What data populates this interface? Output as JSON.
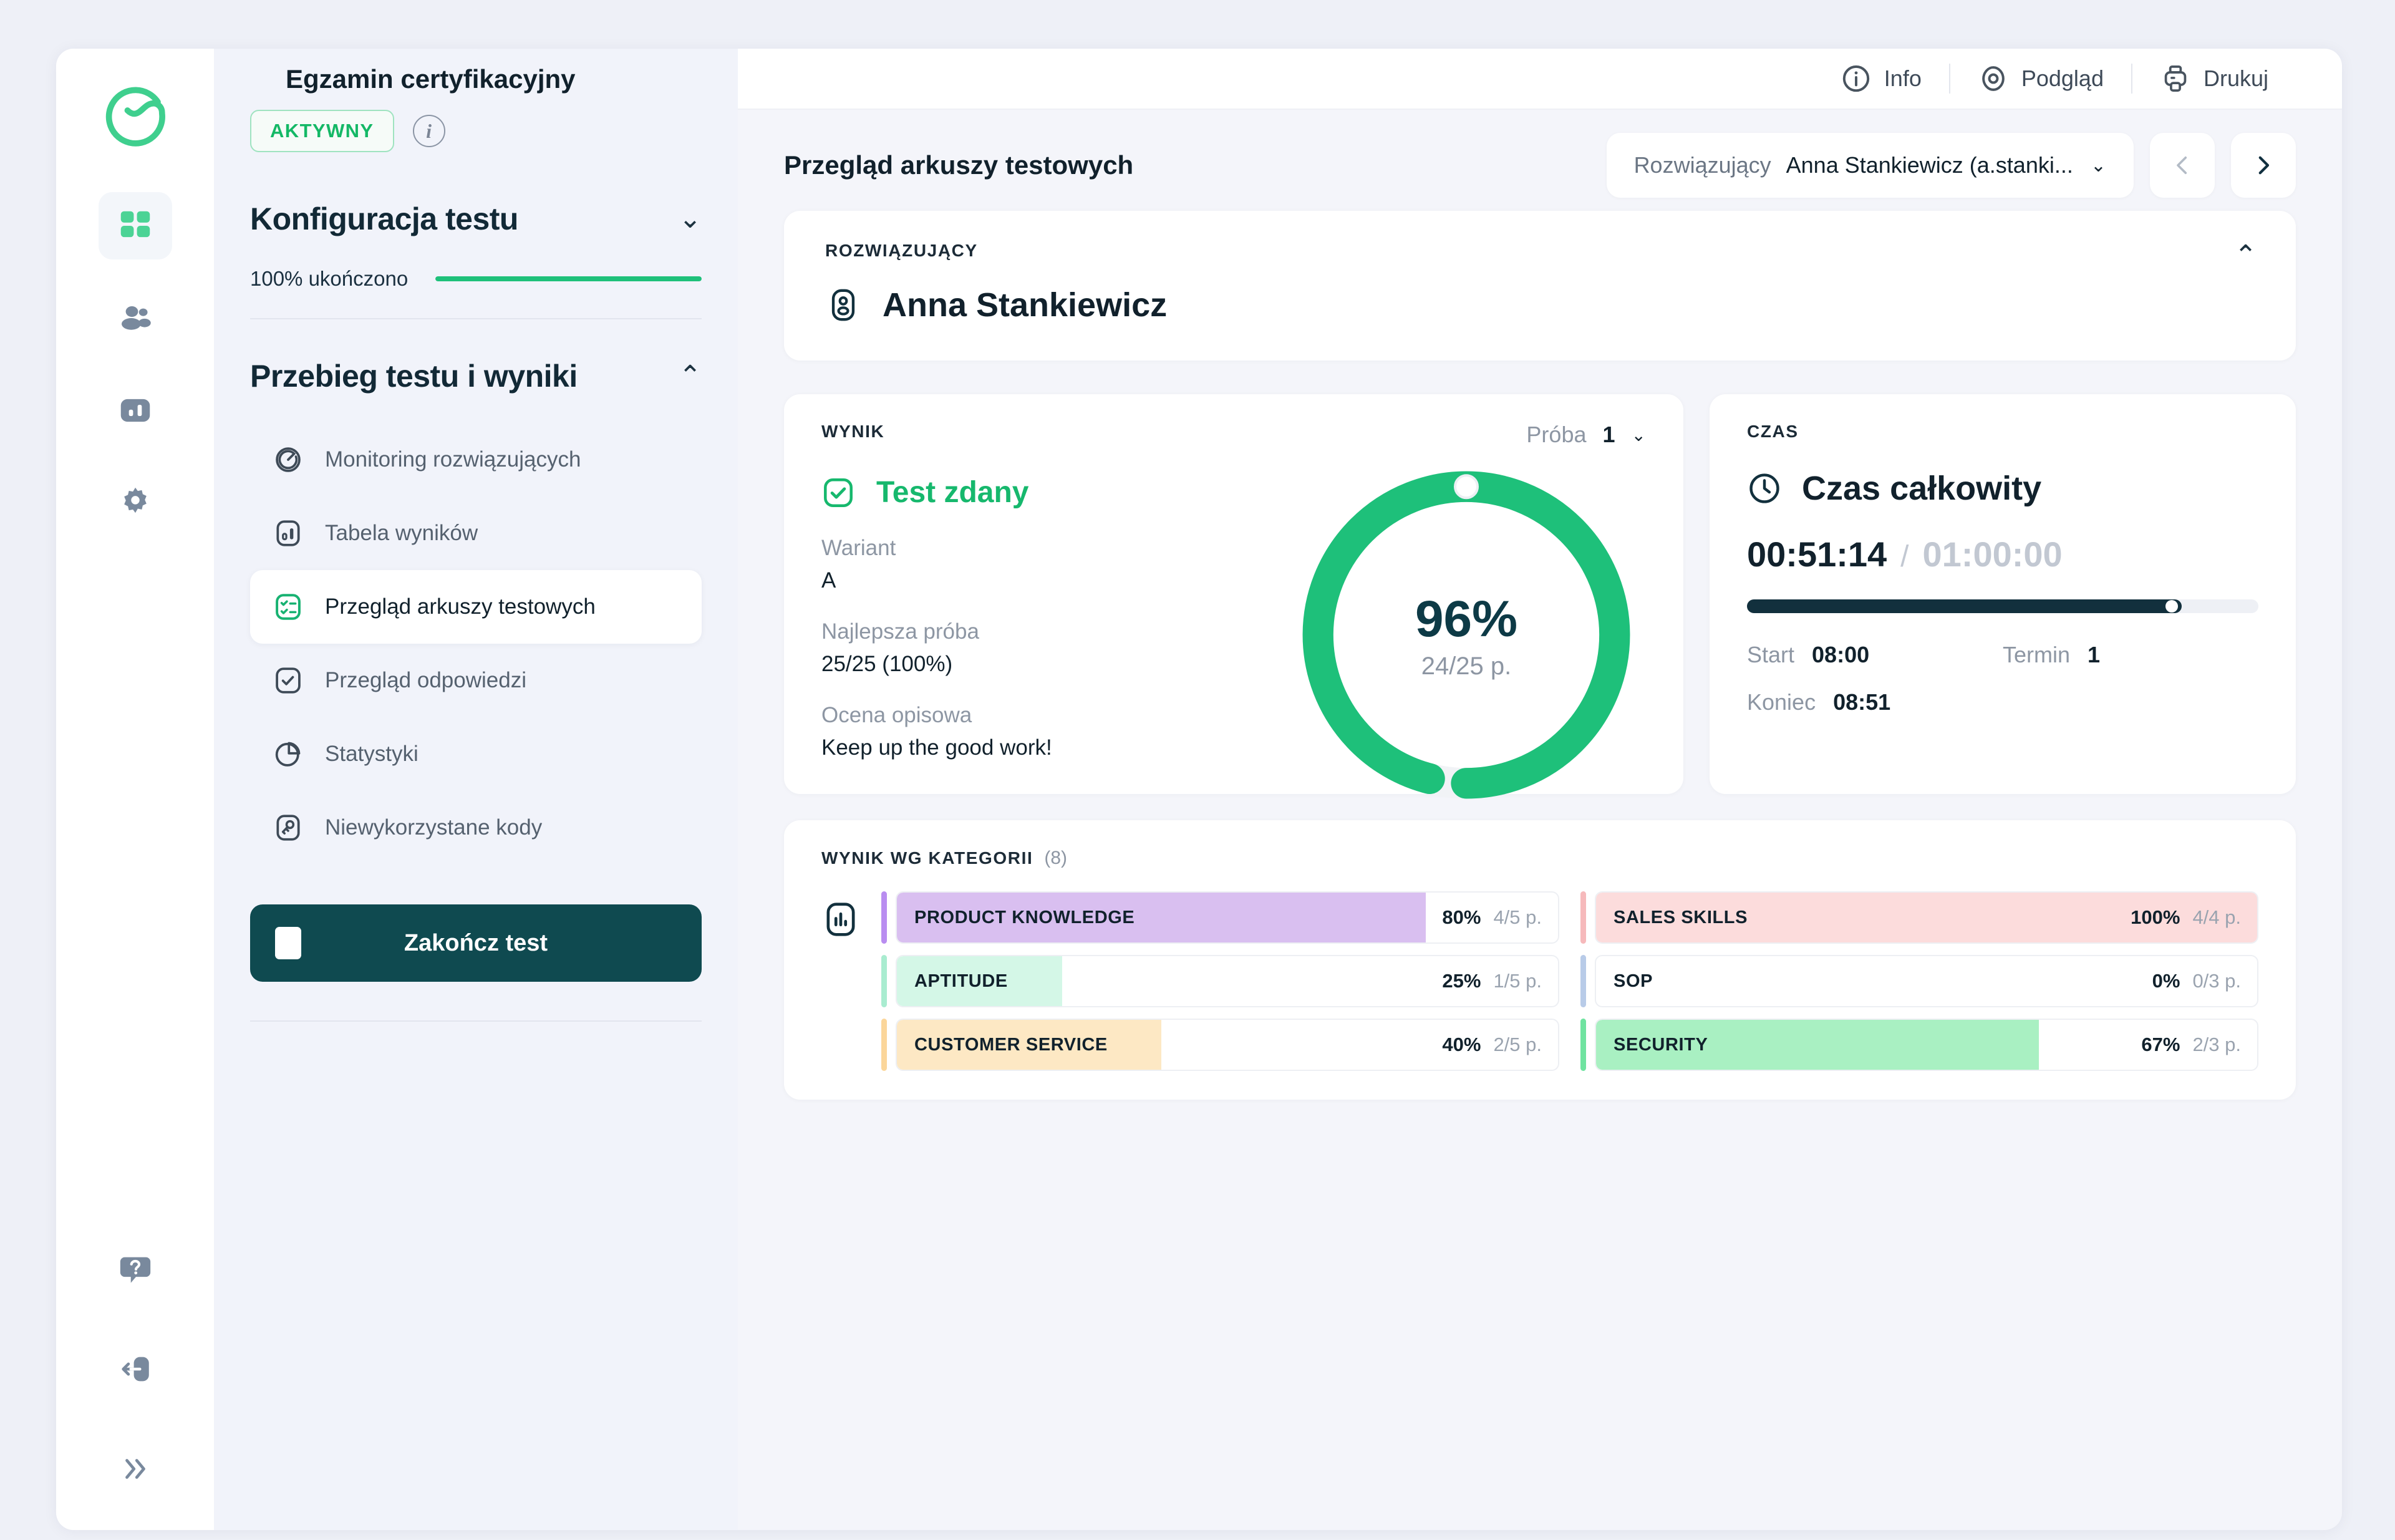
{
  "rail": {
    "logo": "brand-check-logo",
    "items": [
      {
        "icon": "grid-dashboard-icon",
        "active": true
      },
      {
        "icon": "users-icon",
        "active": false
      },
      {
        "icon": "bar-chart-icon",
        "active": false
      },
      {
        "icon": "gear-icon",
        "active": false
      }
    ],
    "bottom": [
      {
        "icon": "help-question-icon"
      },
      {
        "icon": "logout-icon"
      },
      {
        "icon": "expand-chevrons-icon"
      }
    ]
  },
  "topbar": {
    "title": "Egzamin certyfikacyjny",
    "actions": [
      {
        "label": "Info",
        "icon": "info-icon"
      },
      {
        "label": "Podgląd",
        "icon": "eye-preview-icon"
      },
      {
        "label": "Drukuj",
        "icon": "printer-icon"
      }
    ]
  },
  "panel": {
    "status_badge": "AKTYWNY",
    "info_icon": "info-icon",
    "config": {
      "title": "Konfiguracja testu",
      "progress_label": "100% ukończono",
      "progress_percent": 100
    },
    "flow": {
      "title": "Przebieg testu i wyniki",
      "items": [
        {
          "label": "Monitoring rozwiązujących",
          "icon": "monitoring-icon",
          "active": false
        },
        {
          "label": "Tabela wyników",
          "icon": "results-table-icon",
          "active": false
        },
        {
          "label": "Przegląd arkuszy testowych",
          "icon": "test-sheets-icon",
          "active": true
        },
        {
          "label": "Przegląd odpowiedzi",
          "icon": "answers-check-icon",
          "active": false
        },
        {
          "label": "Statystyki",
          "icon": "pie-chart-icon",
          "active": false
        },
        {
          "label": "Niewykorzystane kody",
          "icon": "key-codes-icon",
          "active": false
        }
      ]
    },
    "end_test_button": "Zakończ test"
  },
  "header": {
    "page_title": "Przegląd arkuszy testowych",
    "solver_label": "Rozwiązujący",
    "solver_value": "Anna Stankiewicz (a.stanki...",
    "prev_icon": "chevron-left-icon",
    "next_icon": "chevron-right-icon"
  },
  "solver_card": {
    "label": "ROZWIĄZUJĄCY",
    "name": "Anna Stankiewicz",
    "avatar_icon": "user-badge-icon",
    "collapse_icon": "chevron-up-icon"
  },
  "result_card": {
    "label": "WYNIK",
    "attempt_label": "Próba",
    "attempt_value": "1",
    "pass_text": "Test zdany",
    "pass_icon": "check-square-icon",
    "fields": [
      {
        "key": "Wariant",
        "value": "A"
      },
      {
        "key": "Najlepsza próba",
        "value": "25/25 (100%)"
      },
      {
        "key": "Ocena opisowa",
        "value": "Keep up the good work!"
      }
    ]
  },
  "time_card": {
    "label": "CZAS",
    "title": "Czas całkowity",
    "clock_icon": "clock-icon",
    "current": "00:51:14",
    "separator": "/",
    "total": "01:00:00",
    "progress_percent": 85,
    "rows": [
      {
        "key": "Start",
        "value": "08:00"
      },
      {
        "key": "Termin",
        "value": "1"
      },
      {
        "key": "Koniec",
        "value": "08:51"
      }
    ]
  },
  "categories_card": {
    "label": "WYNIK WG KATEGORII",
    "count": "(8)",
    "icon": "bar-chart-outline-icon"
  },
  "chart_data": {
    "type": "bar",
    "title": "WYNIK WG KATEGORII",
    "xlabel": "",
    "ylabel": "",
    "ylim": [
      0,
      100
    ],
    "unit": "%",
    "left_column": [
      {
        "name": "PRODUCT KNOWLEDGE",
        "percent": 80,
        "points": "4/5 p.",
        "scored": 4,
        "max": 5,
        "fill": "#d9bff0",
        "tick": "#b98df0"
      },
      {
        "name": "APTITUDE",
        "percent": 25,
        "points": "1/5 p.",
        "scored": 1,
        "max": 5,
        "fill": "#d4f7e7",
        "tick": "#a9ecd0"
      },
      {
        "name": "CUSTOMER SERVICE",
        "percent": 40,
        "points": "2/5 p.",
        "scored": 2,
        "max": 5,
        "fill": "#fde8c4",
        "tick": "#fbd69a"
      }
    ],
    "right_column": [
      {
        "name": "SALES SKILLS",
        "percent": 100,
        "points": "4/4 p.",
        "scored": 4,
        "max": 4,
        "fill": "#fcdcdc",
        "tick": "#f6b9bb"
      },
      {
        "name": "SOP",
        "percent": 0,
        "points": "0/3 p.",
        "scored": 0,
        "max": 3,
        "fill": "#ffffff",
        "tick": "#b8cbe8"
      },
      {
        "name": "SECURITY",
        "percent": 67,
        "points": "2/3 p.",
        "scored": 2,
        "max": 3,
        "fill": "#a9f0c2",
        "tick": "#6fe3a0"
      }
    ],
    "donut": {
      "percent": 96,
      "label": "96%",
      "sublabel": "24/25 p.",
      "scored": 24,
      "max": 25,
      "color": "#1ec07a",
      "track": "#f1f3f6"
    }
  },
  "colors": {
    "accent_green": "#1ec07a",
    "dark": "#11212c",
    "teal_button": "#0f4a50"
  }
}
